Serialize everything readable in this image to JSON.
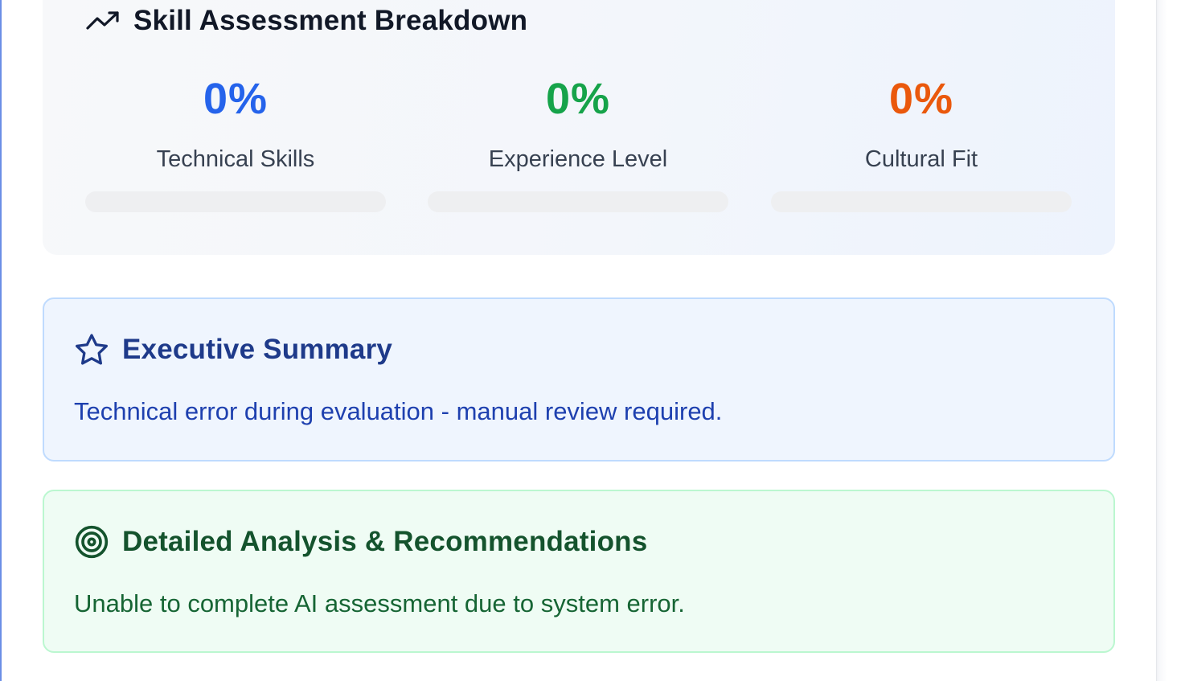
{
  "skills": {
    "title": "Skill Assessment Breakdown",
    "metrics": [
      {
        "value": "0%",
        "label": "Technical Skills",
        "color": "#2563eb",
        "fill_pct": 0
      },
      {
        "value": "0%",
        "label": "Experience Level",
        "color": "#16a34a",
        "fill_pct": 0
      },
      {
        "value": "0%",
        "label": "Cultural Fit",
        "color": "#ea580c",
        "fill_pct": 0
      }
    ]
  },
  "summary": {
    "title": "Executive Summary",
    "icon": "star-icon",
    "text": "Technical error during evaluation - manual review required."
  },
  "analysis": {
    "title": "Detailed Analysis & Recommendations",
    "icon": "target-icon",
    "text": "Unable to complete AI assessment due to system error."
  }
}
